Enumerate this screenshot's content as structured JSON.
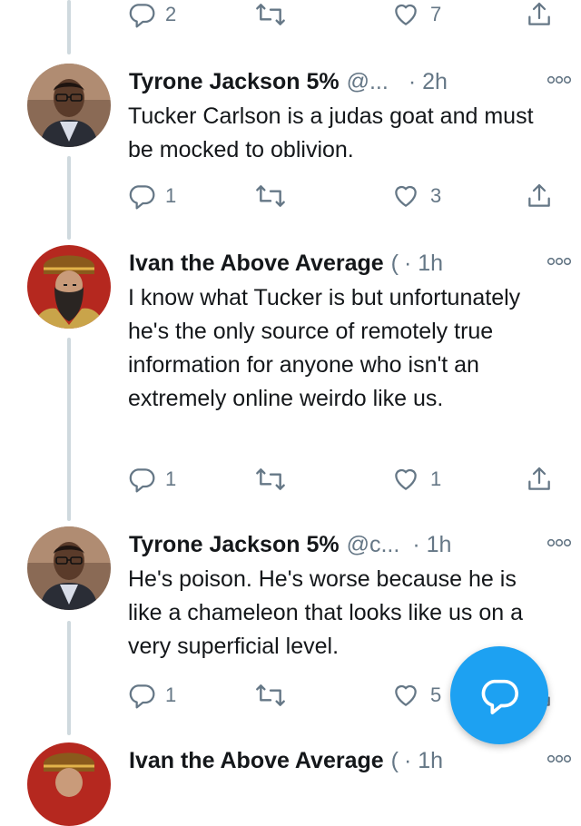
{
  "top_actions": {
    "reply_count": "2",
    "like_count": "7"
  },
  "tweets": [
    {
      "name": "Tyrone Jackson 5%",
      "handle": "@...",
      "time": "· 2h",
      "text": "Tucker Carlson is a judas goat and must be mocked to oblivion.",
      "reply_count": "1",
      "like_count": "3"
    },
    {
      "name": "Ivan the Above Average",
      "handle": "(",
      "time": "· 1h",
      "text": "I know what Tucker is but unfortunately he's the only source of remotely true information for anyone who isn't an extremely online weirdo like us.",
      "reply_count": "1",
      "like_count": "1"
    },
    {
      "name": "Tyrone Jackson 5%",
      "handle": "@c...",
      "time": "· 1h",
      "text": "He's poison. He's worse because he is like a chameleon that looks like us on a very superficial level.",
      "reply_count": "1",
      "like_count": "5"
    },
    {
      "name": "Ivan the Above Average",
      "handle": "(",
      "time": "· 1h"
    }
  ],
  "icons": {
    "reply": "reply-icon",
    "retweet": "retweet-icon",
    "like": "heart-icon",
    "share": "share-icon",
    "more": "more-icon",
    "compose": "compose-reply-icon"
  },
  "colors": {
    "accent": "#1da1f2",
    "muted": "#657786",
    "thread": "#cfd9de"
  }
}
